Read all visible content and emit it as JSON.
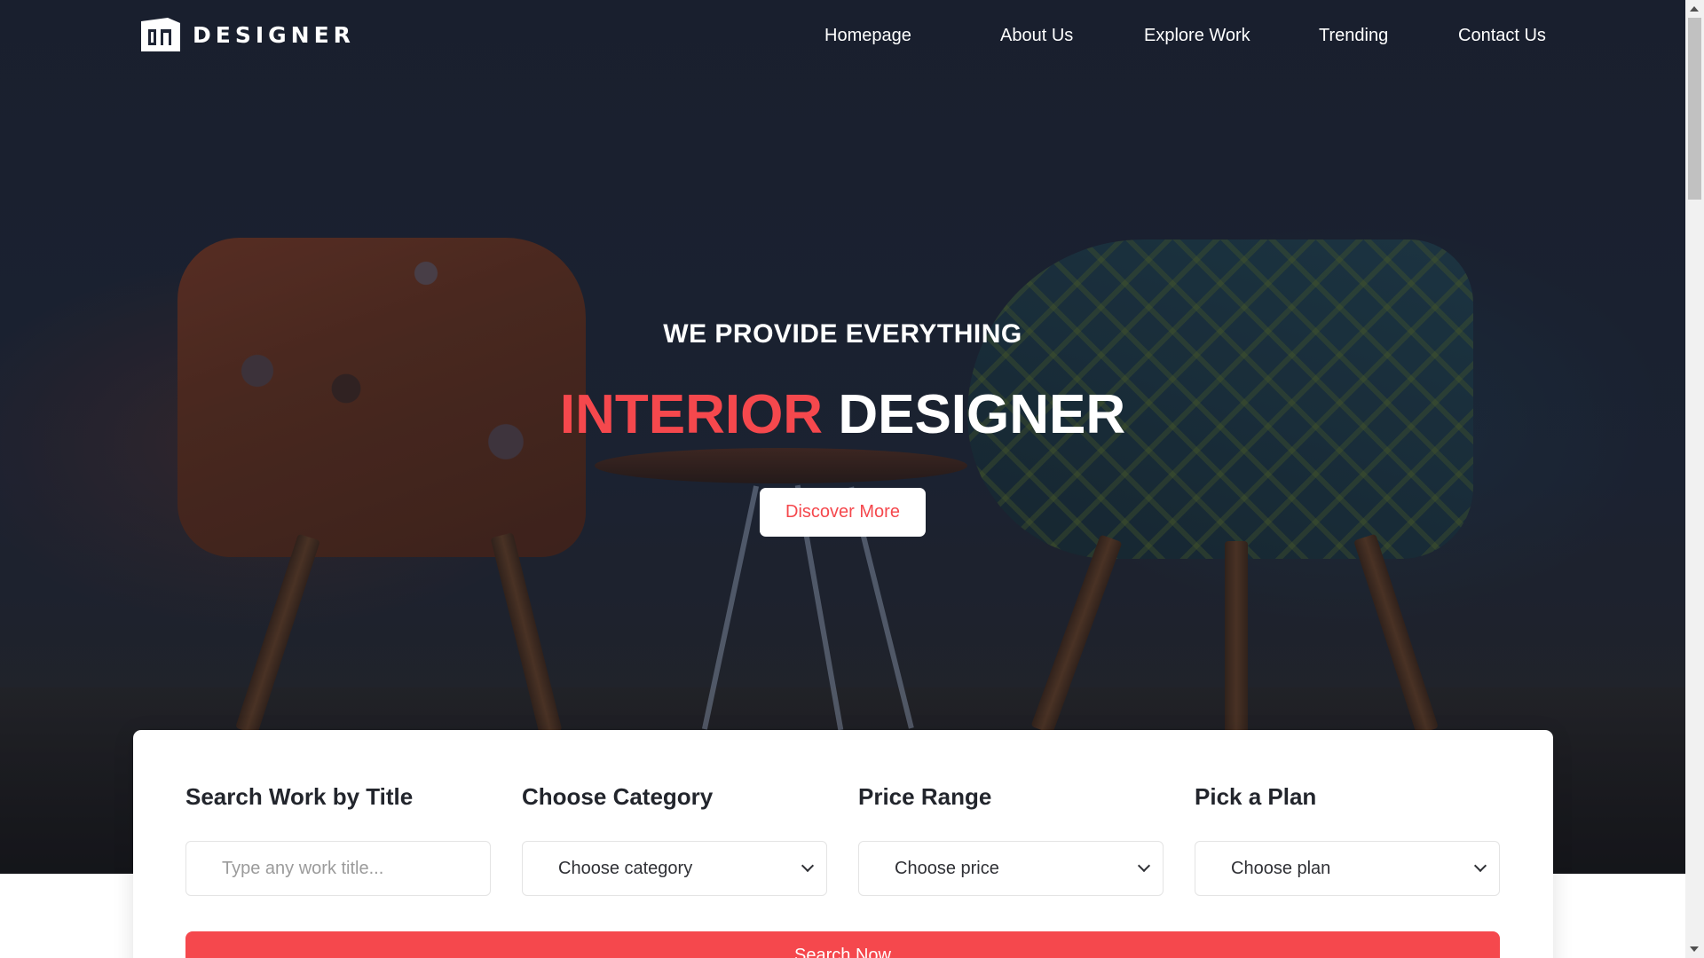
{
  "brand": {
    "logo_icon": "dn-logo-icon",
    "name": "DESIGNER"
  },
  "nav": {
    "items": [
      {
        "label": "Homepage"
      },
      {
        "label": "About Us"
      },
      {
        "label": "Explore Work"
      },
      {
        "label": "Trending"
      },
      {
        "label": "Contact Us"
      }
    ]
  },
  "hero": {
    "subtitle": "WE PROVIDE EVERYTHING",
    "title_accent": "INTERIOR",
    "title_rest": "DESIGNER",
    "cta_label": "Discover More",
    "background": "photo-two-patterned-chairs-and-side-table"
  },
  "search": {
    "title_field": {
      "label": "Search Work by Title",
      "placeholder": "Type any work title..."
    },
    "category_field": {
      "label": "Choose Category",
      "selected": "Choose category"
    },
    "price_field": {
      "label": "Price Range",
      "selected": "Choose price"
    },
    "plan_field": {
      "label": "Pick a Plan",
      "selected": "Choose plan"
    },
    "button_label": "Search Now"
  },
  "colors": {
    "accent": "#f5484d",
    "hero_dark": "#1e2434",
    "text_dark": "#22252c"
  }
}
